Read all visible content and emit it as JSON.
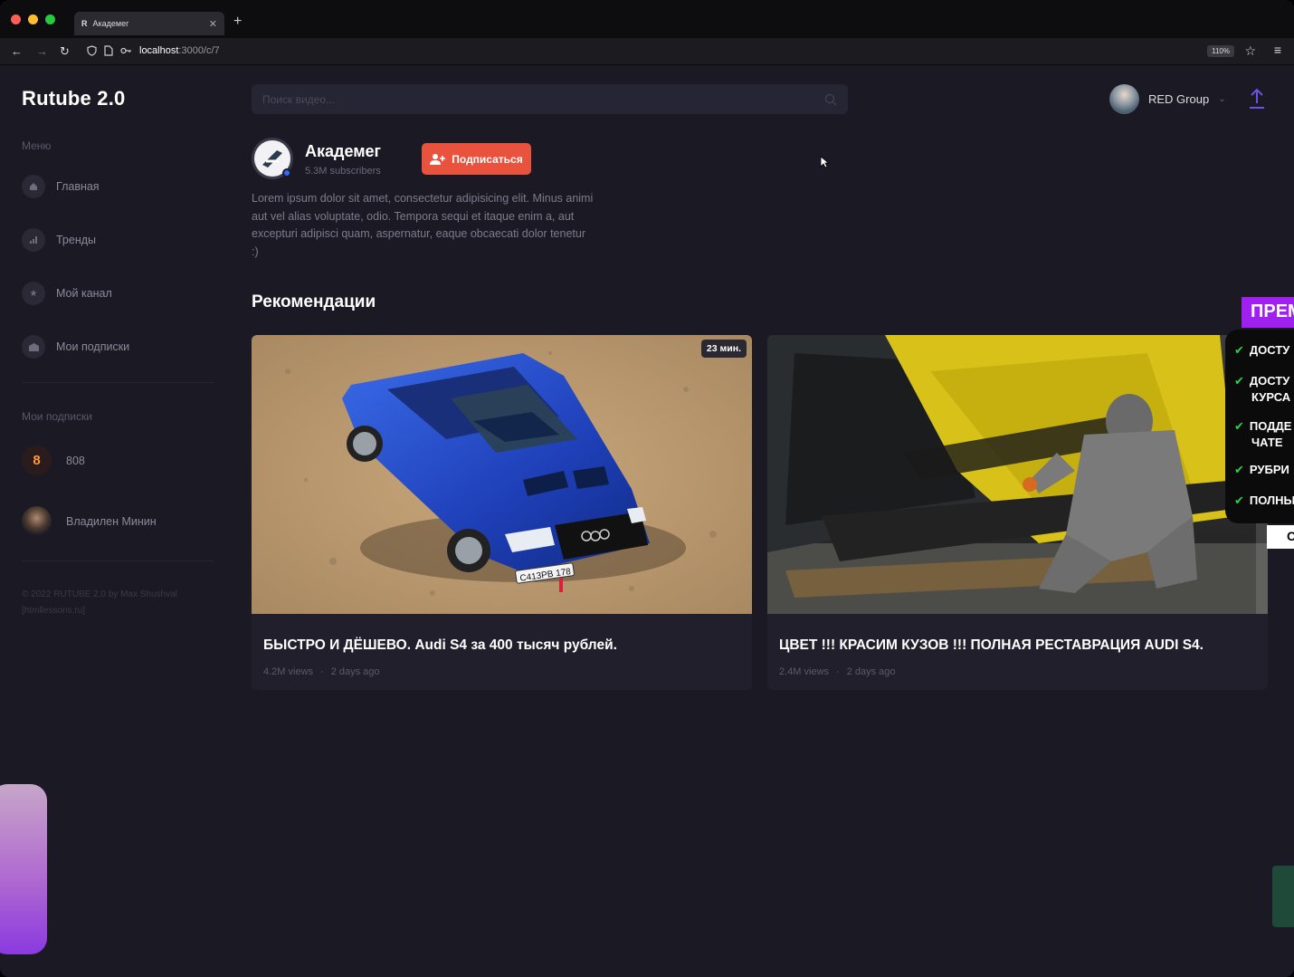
{
  "browser": {
    "tab_title": "Академег",
    "tab_favicon": "R",
    "url_host": "localhost",
    "url_path": ":3000/c/7",
    "zoom": "110%"
  },
  "app": {
    "logo": "Rutube 2.0"
  },
  "search": {
    "placeholder": "Поиск видео..."
  },
  "profile": {
    "name": "RED Group"
  },
  "sidebar": {
    "menu_title": "Меню",
    "items": [
      {
        "label": "Главная",
        "icon": "home-icon"
      },
      {
        "label": "Тренды",
        "icon": "chart-icon"
      },
      {
        "label": "Мой канал",
        "icon": "star-icon"
      },
      {
        "label": "Мои подписки",
        "icon": "folder-icon"
      }
    ],
    "subs_title": "Мои подписки",
    "subscriptions": [
      {
        "name": "808"
      },
      {
        "name": "Владилен Минин"
      }
    ],
    "copyright_line1": "© 2022 RUTUBE 2.0 by Max Shushval",
    "copyright_line2": "[htmllessons.ru]"
  },
  "channel": {
    "name": "Академег",
    "subscribers": "5.3M subscribers",
    "subscribe_label": "Подписаться",
    "description": "Lorem ipsum dolor sit amet, consectetur adipisicing elit. Minus animi aut vel alias voluptate, odio. Tempora sequi et itaque enim a, aut excepturi adipisci quam, aspernatur, eaque obcaecati dolor tenetur :)"
  },
  "recommendations": {
    "title": "Рекомендации",
    "videos": [
      {
        "title": "БЫСТРО И ДЁШЕВО. Audi S4 за 400 тысяч рублей.",
        "views": "4.2M views",
        "age": "2 days ago",
        "duration": "23 мин.",
        "plate": "С413РВ 178"
      },
      {
        "title": "ЦВЕТ !!! КРАСИМ КУЗОВ !!! ПОЛНАЯ РЕСТАВРАЦИЯ AUDI S4.",
        "views": "2.4M views",
        "age": "2 days ago",
        "duration": ""
      }
    ]
  },
  "promo": {
    "header": "ПРЕМ",
    "lines": [
      "ДОСТУ",
      "ДОСТУ",
      "КУРСА",
      "ПОДДЕ",
      "ЧАТЕ",
      "РУБРИ",
      "ПОЛНЫ"
    ],
    "footer": "С"
  },
  "colors": {
    "background": "#1b1a24",
    "accent": "#e9523c",
    "upload": "#6b52e0"
  }
}
